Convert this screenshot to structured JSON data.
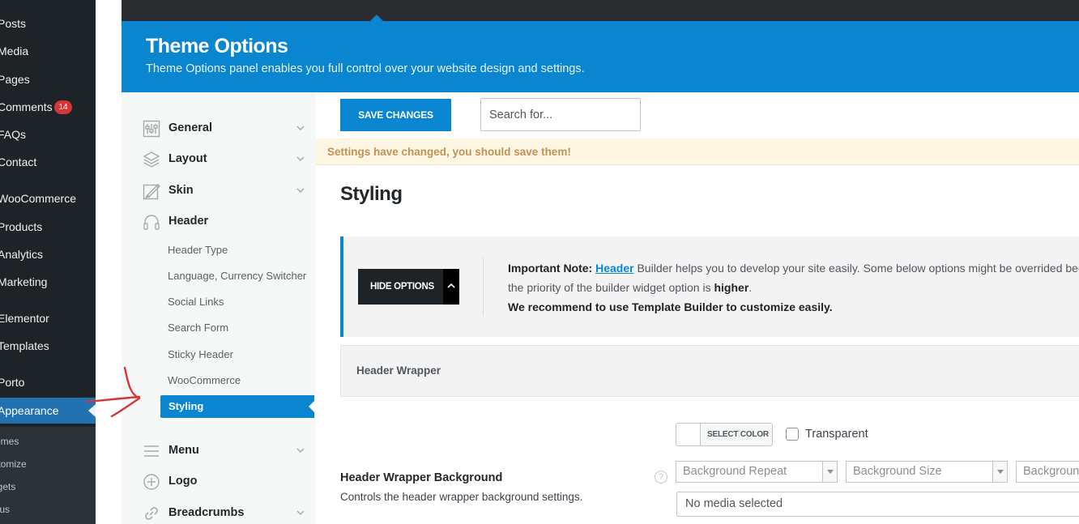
{
  "wp_menu": {
    "items": [
      {
        "label": "Posts"
      },
      {
        "label": "Media"
      },
      {
        "label": "Pages"
      },
      {
        "label": "Comments",
        "badge": "14"
      },
      {
        "label": "FAQs"
      },
      {
        "label": "Contact"
      },
      {
        "label": "WooCommerce"
      },
      {
        "label": "Products"
      },
      {
        "label": "Analytics"
      },
      {
        "label": "Marketing"
      },
      {
        "label": "Elementor"
      },
      {
        "label": "Templates"
      },
      {
        "label": "Porto"
      },
      {
        "label": "Appearance",
        "active": true
      }
    ],
    "sub_items": [
      {
        "label": "Themes"
      },
      {
        "label": "Customize"
      },
      {
        "label": "Widgets"
      },
      {
        "label": "Menus"
      }
    ]
  },
  "header": {
    "title": "Theme Options",
    "subtitle": "Theme Options panel enables you full control over your website design and settings."
  },
  "nav": {
    "sections": [
      {
        "label": "General",
        "icon": "sliders-icon",
        "chevron": true
      },
      {
        "label": "Layout",
        "icon": "layers-icon",
        "chevron": true
      },
      {
        "label": "Skin",
        "icon": "paint-icon",
        "chevron": true
      },
      {
        "label": "Header",
        "icon": "headphones-icon",
        "chevron": false
      },
      {
        "label": "Menu",
        "icon": "menu-icon",
        "chevron": true
      },
      {
        "label": "Logo",
        "icon": "plus-circle-icon",
        "chevron": false
      },
      {
        "label": "Breadcrumbs",
        "icon": "link-icon",
        "chevron": true
      }
    ],
    "header_sub_items": [
      {
        "label": "Header Type"
      },
      {
        "label": "Language, Currency Switcher"
      },
      {
        "label": "Social Links"
      },
      {
        "label": "Search Form"
      },
      {
        "label": "Sticky Header"
      },
      {
        "label": "WooCommerce"
      },
      {
        "label": "Styling",
        "active": true
      }
    ]
  },
  "toolbar": {
    "save_label": "SAVE CHANGES",
    "search_placeholder": "Search for..."
  },
  "notice": {
    "text": "Settings have changed, you should save them!"
  },
  "section": {
    "title": "Styling"
  },
  "note": {
    "hide_button": "HIDE OPTIONS",
    "prefix": "Important Note:",
    "link": "Header",
    "line1_rest": " Builder helps you to develop your site easily. Some below options might be overrided because",
    "line2_pre": "the priority of the builder widget option is ",
    "line2_bold": "higher",
    "line2_post": ".",
    "line3": "We recommend to use Template Builder to customize easily."
  },
  "wrapper_panel": {
    "label": "Header Wrapper"
  },
  "field": {
    "color_button": "SELECT COLOR",
    "transparent_label": "Transparent",
    "title": "Header Wrapper Background",
    "description": "Controls the header wrapper background settings.",
    "help": "?",
    "selects": [
      {
        "placeholder": "Background Repeat"
      },
      {
        "placeholder": "Background Size"
      },
      {
        "placeholder": "Background Attachment"
      }
    ],
    "media": "No media selected"
  },
  "colors": {
    "accent": "#0a85d0",
    "wp_sidebar": "#1d2327",
    "wp_active": "#2271b1",
    "badge": "#d63638",
    "warning_bg": "#fcf6e2",
    "warning_text": "#c2925a",
    "annotation_arrow": "#d63638"
  }
}
